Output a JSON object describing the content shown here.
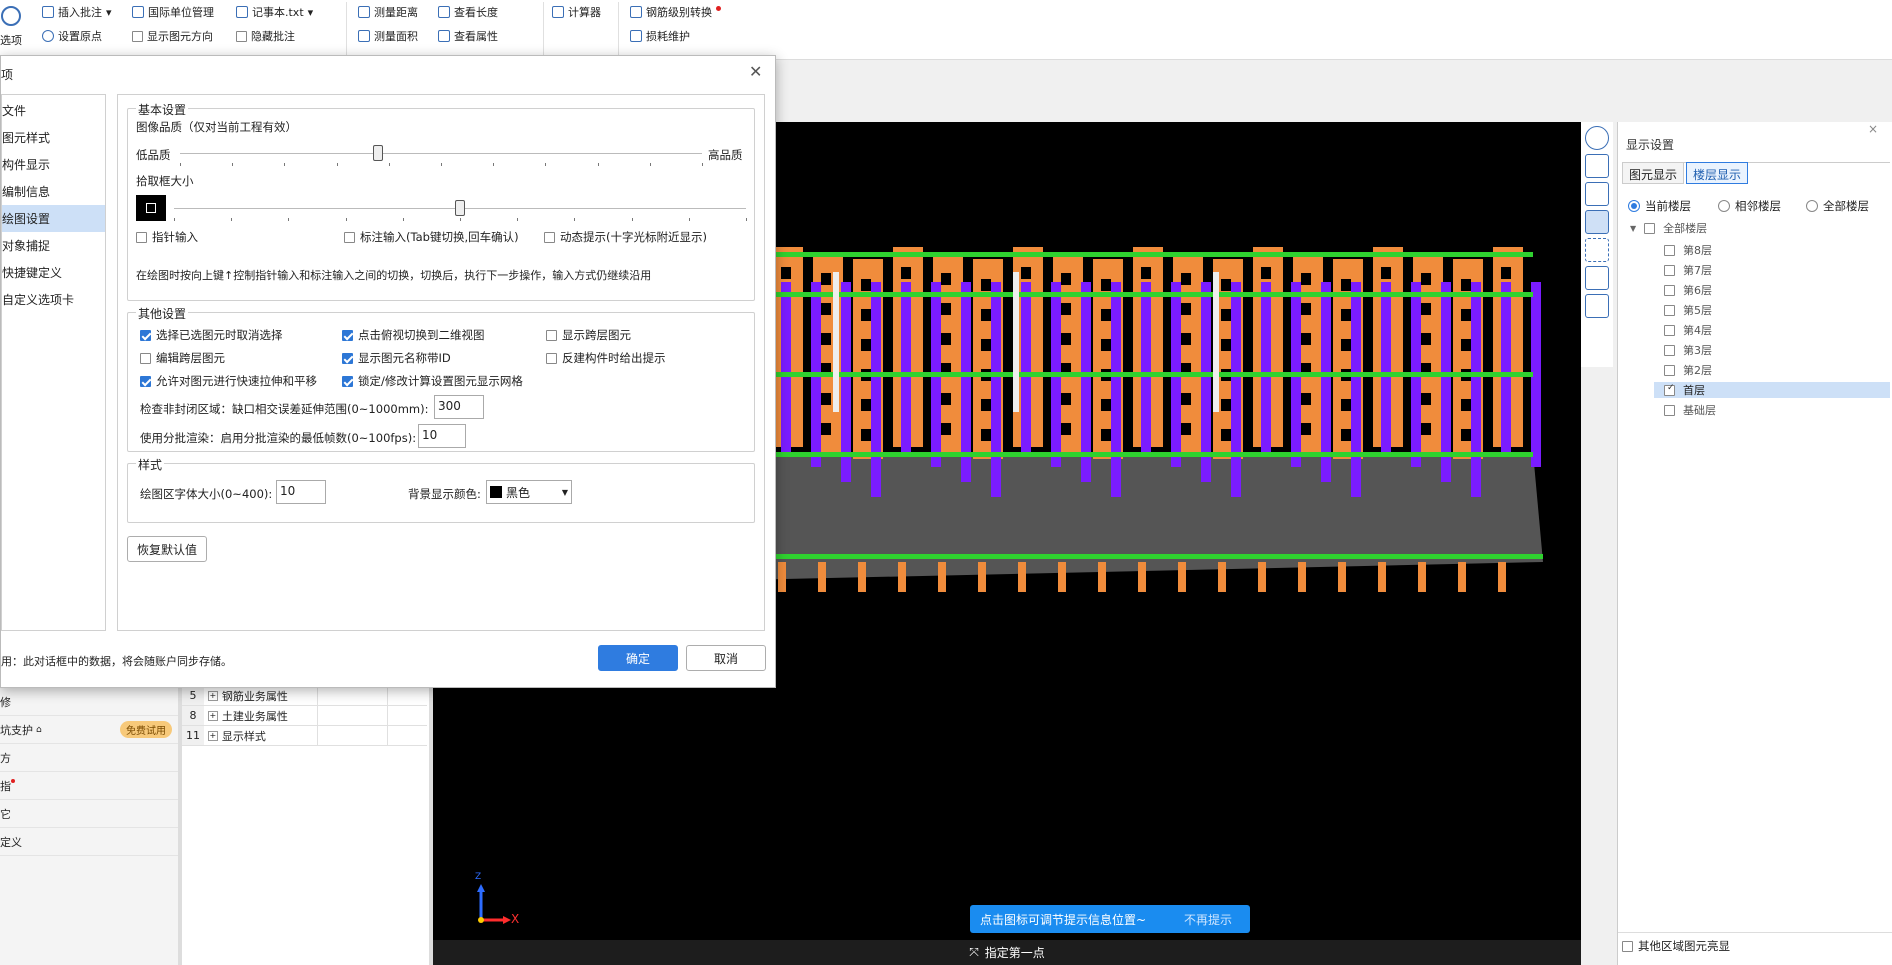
{
  "ribbon": {
    "col1": {
      "options_label": "选项",
      "insert_note": "插入批注",
      "set_origin": "设置原点",
      "show_direction": "显示图元方向"
    },
    "col2": {
      "intl_units": "国际单位管理",
      "hide_note": "隐藏批注"
    },
    "col3": {
      "notepad": "记事本.txt"
    },
    "col4": {
      "measure_distance": "测量距离",
      "measure_area": "测量面积",
      "view_length": "查看长度",
      "view_props": "查看属性"
    },
    "col5": {
      "calculator": "计算器"
    },
    "col6": {
      "rebar_convert": "钢筋级别转换",
      "loss_maintain": "损耗维护"
    }
  },
  "dialog": {
    "title": "项",
    "nav": [
      "文件",
      "图元样式",
      "构件显示",
      "编制信息",
      "绘图设置",
      "对象捕捉",
      "快捷键定义",
      "自定义选项卡"
    ],
    "nav_selected_index": 4,
    "basic": {
      "title": "基本设置",
      "image_quality": "图像品质（仅对当前工程有效）",
      "low": "低品质",
      "high": "高品质",
      "image_quality_level": 0.38,
      "pick_size": "拾取框大小",
      "pick_size_level": 0.5,
      "pointer_input": "指针输入",
      "mark_input": "标注输入(Tab键切换,回车确认)",
      "dynamic_hint": "动态提示(十字光标附近显示)",
      "note": "在绘图时按向上键↑控制指针输入和标注输入之间的切换，切换后，执行下一步操作，输入方式仍继续沿用"
    },
    "other": {
      "title": "其他设置",
      "opt1": "选择已选图元时取消选择",
      "opt2": "点击俯视切换到二维视图",
      "opt3": "显示跨层图元",
      "opt4": "编辑跨层图元",
      "opt5": "显示图元名称带ID",
      "opt6": "反建构件时给出提示",
      "opt7": "允许对图元进行快速拉伸和平移",
      "opt8": "锁定/修改计算设置图元显示网格",
      "check_label": "检查非封闭区域：缺口相交误差延伸范围(0~1000mm):",
      "check_value": "300",
      "batch_label": "使用分批渲染：启用分批渲染的最低帧数(0~100fps):",
      "batch_value": "10"
    },
    "style": {
      "title": "样式",
      "font_label": "绘图区字体大小(0~400):",
      "font_value": "10",
      "bg_label": "背景显示颜色:",
      "bg_value": "黑色"
    },
    "restore": "恢复默认值",
    "footer_note": "用：此对话框中的数据，将会随账户同步存储。",
    "ok": "确定",
    "cancel": "取消"
  },
  "left_panel": {
    "items": [
      "修",
      "坑支护",
      "方",
      "指",
      "它",
      "定义"
    ],
    "badge": "免费试用"
  },
  "prop_table": {
    "rows": [
      {
        "num": "5",
        "label": "钢筋业务属性"
      },
      {
        "num": "8",
        "label": "土建业务属性"
      },
      {
        "num": "11",
        "label": "显示样式"
      }
    ]
  },
  "right_panel": {
    "title": "显示设置",
    "tab1": "图元显示",
    "tab2": "楼层显示",
    "radio1": "当前楼层",
    "radio2": "相邻楼层",
    "radio3": "全部楼层",
    "all_floors": "全部楼层",
    "floors": [
      "第8层",
      "第7层",
      "第6层",
      "第5层",
      "第4层",
      "第3层",
      "第2层",
      "首层",
      "基础层"
    ],
    "checked_floor": "首层",
    "bottom_option": "其他区域图元亮显"
  },
  "viewport": {
    "hint": "点击图标可调节提示信息位置~",
    "hint_dismiss": "不再提示",
    "status": "指定第一点",
    "axis_x": "X",
    "axis_z": "Z"
  },
  "colors": {
    "accent": "#2f7ce0",
    "building_orange": "#f08c3c",
    "building_purple": "#7a1cff",
    "building_green": "#2fd12f"
  }
}
